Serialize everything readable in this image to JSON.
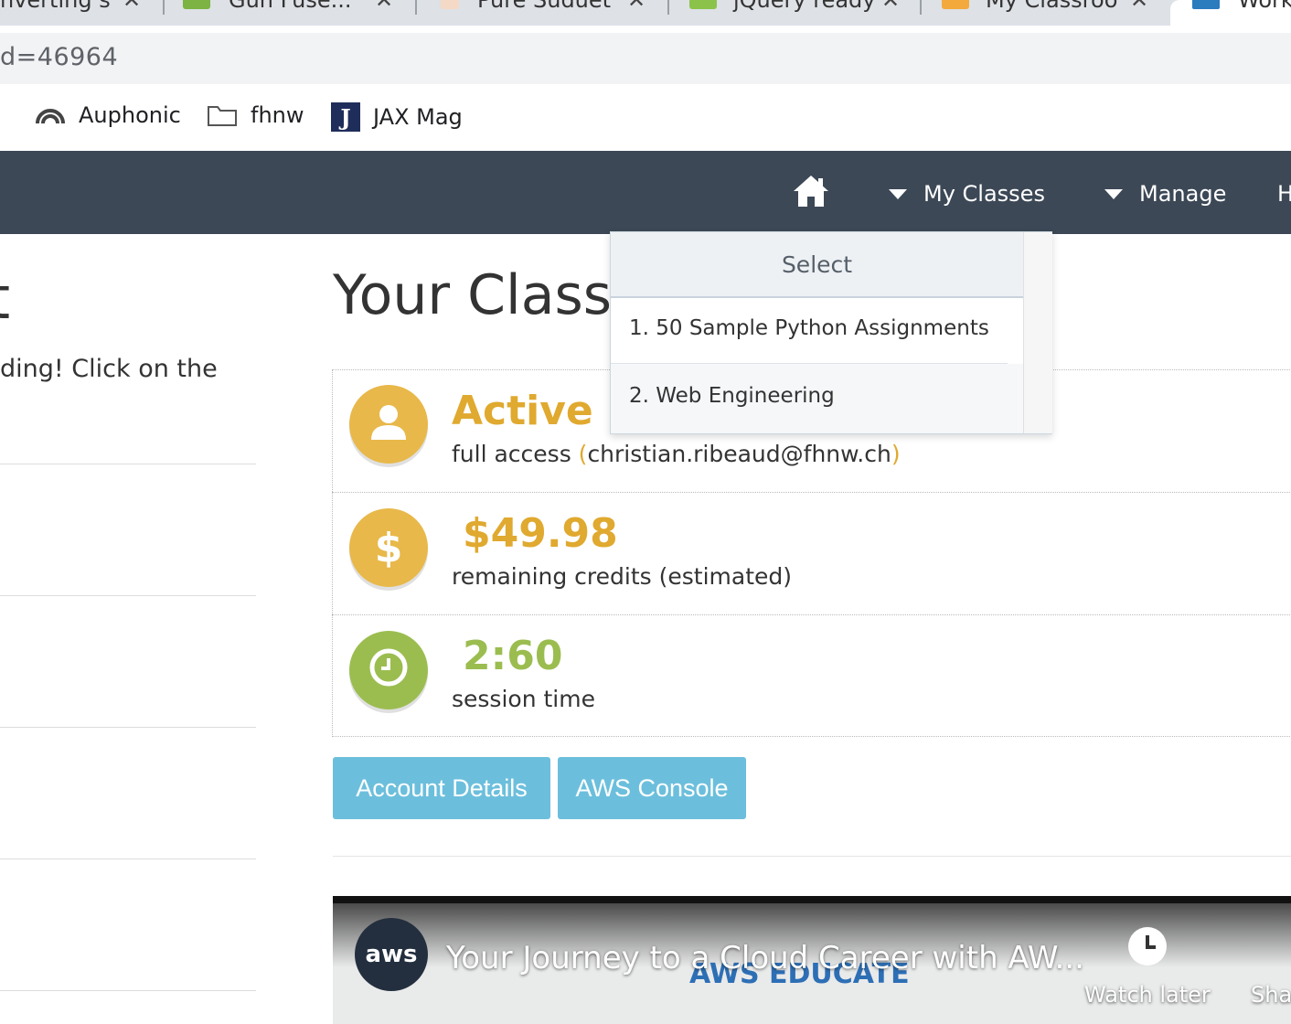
{
  "browser": {
    "tabs": [
      {
        "title": "nverting s",
        "favicon": "generic-favicon"
      },
      {
        "title": "Gun Fuse...",
        "favicon": "image-favicon"
      },
      {
        "title": "Pure Suduet",
        "favicon": "doc-favicon"
      },
      {
        "title": "jQuery ready",
        "favicon": "jquery-favicon"
      },
      {
        "title": "My Classroo",
        "favicon": "books-favicon"
      },
      {
        "title": "Work",
        "favicon": "work-favicon"
      }
    ],
    "url": "d=46964",
    "bookmarks": [
      {
        "label": "Auphonic",
        "icon": "auphonic-icon"
      },
      {
        "label": "fhnw",
        "icon": "folder-icon"
      },
      {
        "label": "JAX Mag",
        "icon": "jax-icon"
      }
    ]
  },
  "nav": {
    "home_icon": "home-icon",
    "my_classes": "My Classes",
    "manage": "Manage",
    "partial": "H"
  },
  "left": {
    "heading_fragment": "t",
    "text_fragment": "ding! Click on the"
  },
  "main": {
    "title": "Your Classroom Status",
    "status": {
      "state": "Active",
      "access_prefix": "full access ",
      "paren_open": "(",
      "email": "christian.ribeaud@fhnw.ch",
      "paren_close": ")",
      "credits": "$49.98",
      "credits_label": "remaining credits (estimated)",
      "session": "2:60",
      "session_label": "session time"
    },
    "buttons": {
      "account_details": "Account Details",
      "aws_console": "AWS Console"
    }
  },
  "dropdown": {
    "header": "Select",
    "items": [
      "1. 50 Sample Python Assignments",
      "2. Web Engineering"
    ]
  },
  "video": {
    "channel": "aws",
    "title": "Your Journey to a Cloud Career with AW...",
    "art_text": "AWS EDUCATE",
    "watch_later": "Watch later",
    "share": "Sha"
  },
  "colors": {
    "navbar": "#3c4856",
    "accent_yellow": "#e8b84a",
    "accent_green": "#9bbd50",
    "button": "#6cbfdc"
  }
}
